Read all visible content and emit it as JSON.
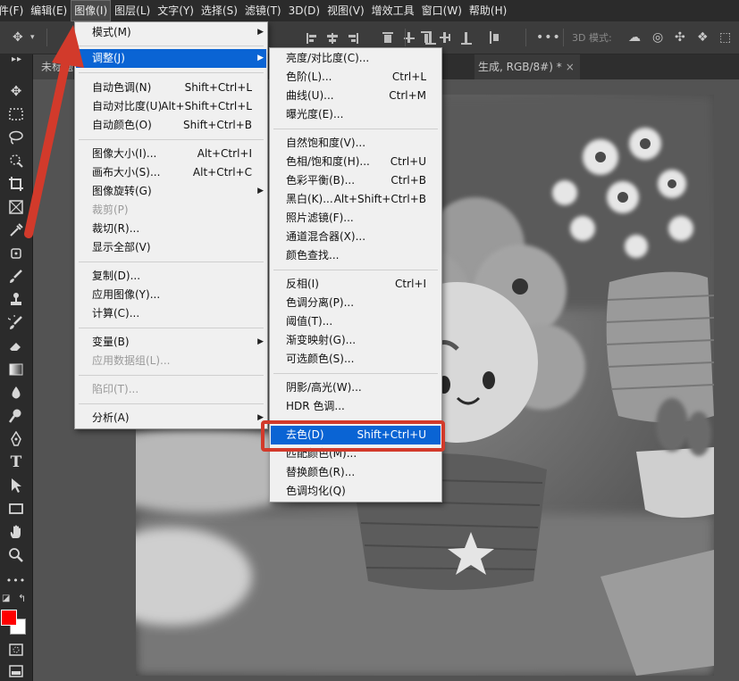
{
  "menubar": {
    "items": [
      "文件(F)",
      "编辑(E)",
      "图像(I)",
      "图层(L)",
      "文字(Y)",
      "选择(S)",
      "滤镜(T)",
      "3D(D)",
      "视图(V)",
      "增效工具",
      "窗口(W)",
      "帮助(H)"
    ],
    "first_visible": "件(F)",
    "active_index": 2
  },
  "options_bar": {
    "label_3d": "3D 模式:",
    "icons": [
      "move-icon",
      "align-icons",
      "distribute-icons",
      "more-icon",
      "3d-orbit-icon",
      "3d-roll-icon",
      "3d-pan-icon",
      "3d-slide-icon",
      "3d-scale-icon"
    ]
  },
  "tabs": {
    "tab1": "未标题",
    "tab2": "生成, RGB/8#) *",
    "close": "×"
  },
  "image_menu": {
    "items": [
      {
        "label": "模式(M)",
        "shortcut": "",
        "submenu": true,
        "disabled": false
      },
      {
        "label": "调整(J)",
        "shortcut": "",
        "submenu": true,
        "disabled": false,
        "highlight": true
      },
      {
        "label": "自动色调(N)",
        "shortcut": "Shift+Ctrl+L",
        "disabled": false
      },
      {
        "label": "自动对比度(U)",
        "shortcut": "Alt+Shift+Ctrl+L",
        "disabled": false
      },
      {
        "label": "自动颜色(O)",
        "shortcut": "Shift+Ctrl+B",
        "disabled": false
      },
      {
        "label": "图像大小(I)...",
        "shortcut": "Alt+Ctrl+I",
        "disabled": false
      },
      {
        "label": "画布大小(S)...",
        "shortcut": "Alt+Ctrl+C",
        "disabled": false
      },
      {
        "label": "图像旋转(G)",
        "shortcut": "",
        "submenu": true,
        "disabled": false
      },
      {
        "label": "裁剪(P)",
        "shortcut": "",
        "disabled": true
      },
      {
        "label": "裁切(R)...",
        "shortcut": "",
        "disabled": false
      },
      {
        "label": "显示全部(V)",
        "shortcut": "",
        "disabled": false
      },
      {
        "label": "复制(D)...",
        "shortcut": "",
        "disabled": false
      },
      {
        "label": "应用图像(Y)...",
        "shortcut": "",
        "disabled": false
      },
      {
        "label": "计算(C)...",
        "shortcut": "",
        "disabled": false
      },
      {
        "label": "变量(B)",
        "shortcut": "",
        "submenu": true,
        "disabled": false
      },
      {
        "label": "应用数据组(L)...",
        "shortcut": "",
        "disabled": true
      },
      {
        "label": "陷印(T)...",
        "shortcut": "",
        "disabled": true
      },
      {
        "label": "分析(A)",
        "shortcut": "",
        "submenu": true,
        "disabled": false
      }
    ]
  },
  "adjust_menu": {
    "items": [
      {
        "label": "亮度/对比度(C)...",
        "shortcut": ""
      },
      {
        "label": "色阶(L)...",
        "shortcut": "Ctrl+L"
      },
      {
        "label": "曲线(U)...",
        "shortcut": "Ctrl+M"
      },
      {
        "label": "曝光度(E)...",
        "shortcut": ""
      },
      {
        "label": "自然饱和度(V)...",
        "shortcut": ""
      },
      {
        "label": "色相/饱和度(H)...",
        "shortcut": "Ctrl+U"
      },
      {
        "label": "色彩平衡(B)...",
        "shortcut": "Ctrl+B"
      },
      {
        "label": "黑白(K)...",
        "shortcut": "Alt+Shift+Ctrl+B"
      },
      {
        "label": "照片滤镜(F)...",
        "shortcut": ""
      },
      {
        "label": "通道混合器(X)...",
        "shortcut": ""
      },
      {
        "label": "颜色查找...",
        "shortcut": ""
      },
      {
        "label": "反相(I)",
        "shortcut": "Ctrl+I"
      },
      {
        "label": "色调分离(P)...",
        "shortcut": ""
      },
      {
        "label": "阈值(T)...",
        "shortcut": ""
      },
      {
        "label": "渐变映射(G)...",
        "shortcut": ""
      },
      {
        "label": "可选颜色(S)...",
        "shortcut": ""
      },
      {
        "label": "阴影/高光(W)...",
        "shortcut": ""
      },
      {
        "label": "HDR 色调...",
        "shortcut": ""
      },
      {
        "label": "去色(D)",
        "shortcut": "Shift+Ctrl+U",
        "highlight": true
      },
      {
        "label": "匹配颜色(M)...",
        "shortcut": ""
      },
      {
        "label": "替换颜色(R)...",
        "shortcut": ""
      },
      {
        "label": "色调均化(Q)",
        "shortcut": ""
      }
    ]
  },
  "colors": {
    "foreground": "#ff0000",
    "background": "#ffffff",
    "highlight": "#0a64d4",
    "annotation": "#d23a2b"
  }
}
